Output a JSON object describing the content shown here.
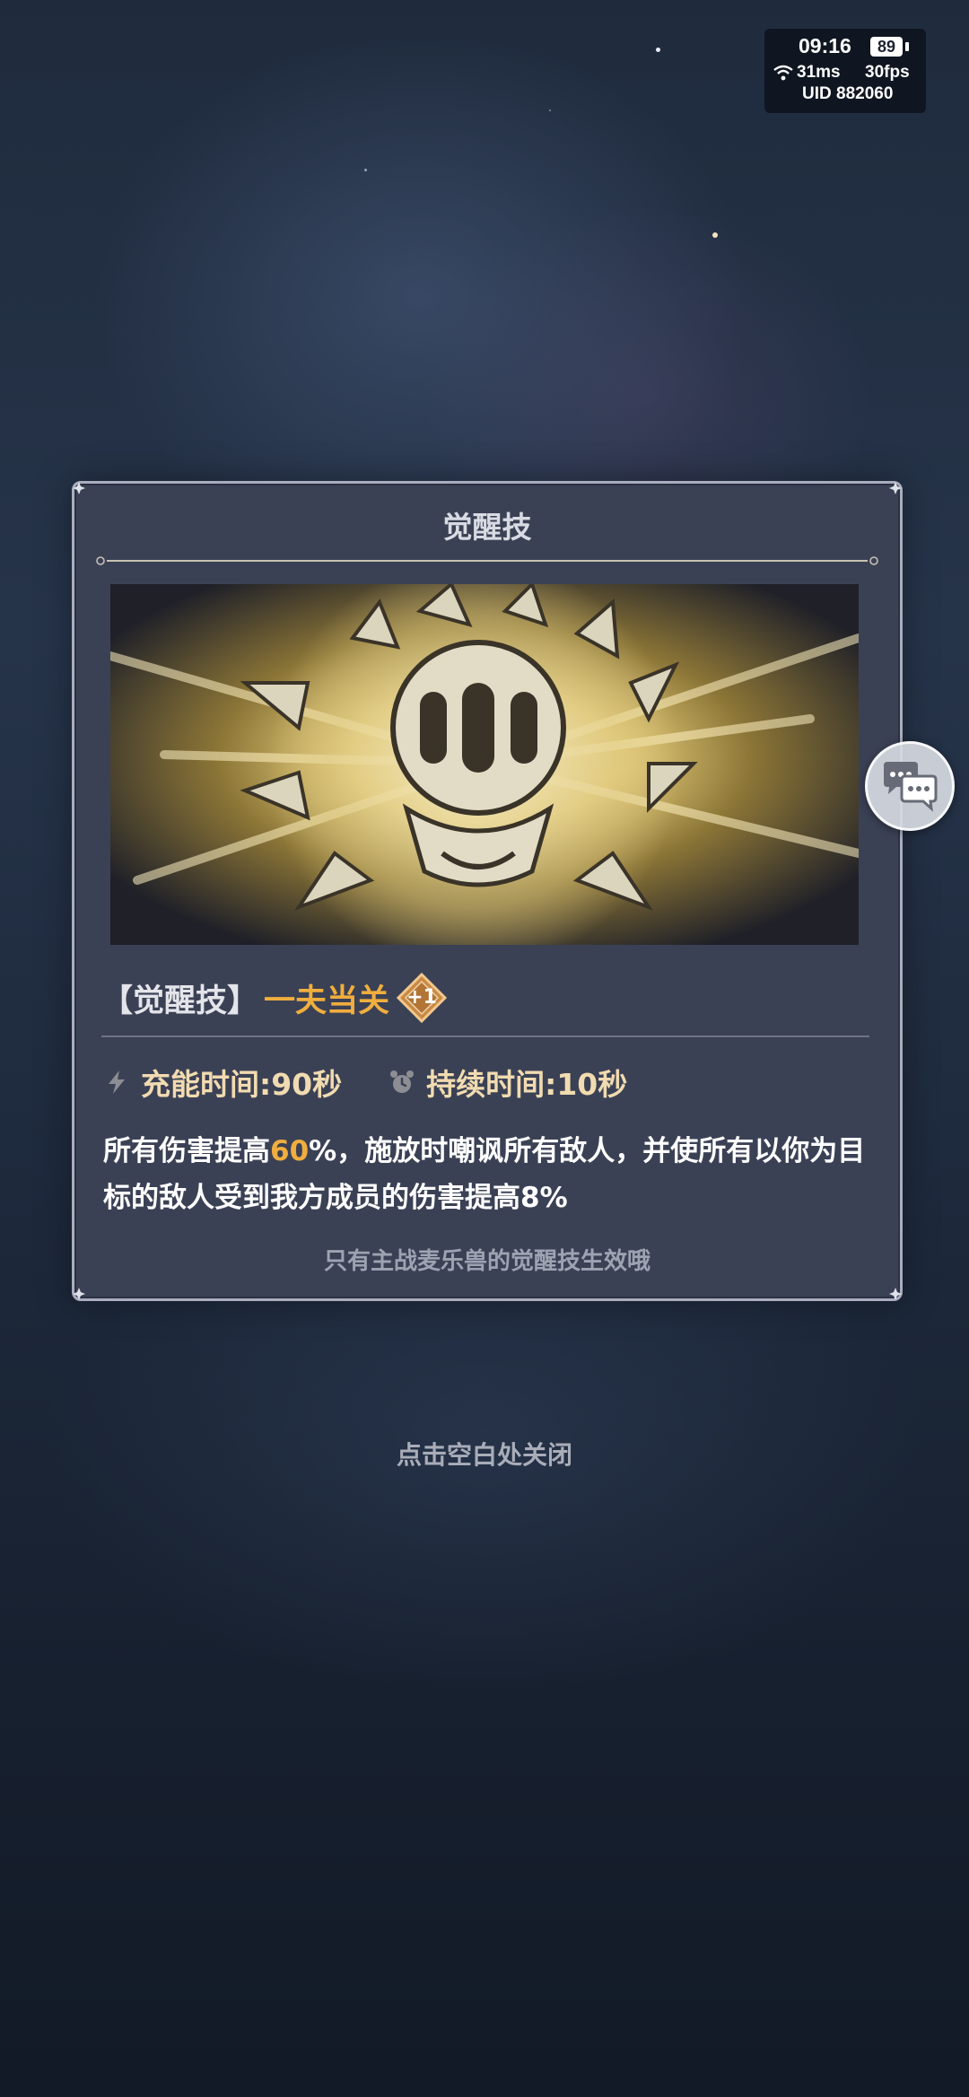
{
  "status": {
    "time": "09:16",
    "battery": "89",
    "ping": "31ms",
    "fps": "30fps",
    "uid": "UID  882060"
  },
  "dialog": {
    "title": "觉醒技",
    "skill_type": "【觉醒技】",
    "skill_name": "一夫当关",
    "level_badge": "+1",
    "charge_time": "充能时间:90秒",
    "duration": "持续时间:10秒",
    "description_part1": "所有伤害提高",
    "description_highlight": "60",
    "description_part2": "%，施放时嘲讽所有敌人，并使所有以你为目标的敌人受到我方成员的伤害提高8%",
    "note": "只有主战麦乐兽的觉醒技生效哦"
  },
  "close_hint": "点击空白处关闭",
  "icons": {
    "charge": "lightning-icon",
    "duration": "alarm-clock-icon",
    "chat": "chat-bubbles-icon",
    "network": "wifi-icon"
  },
  "colors": {
    "highlight": "#f0ae3e",
    "panel": "#3b4155",
    "stat_text": "#f1dbb0"
  }
}
